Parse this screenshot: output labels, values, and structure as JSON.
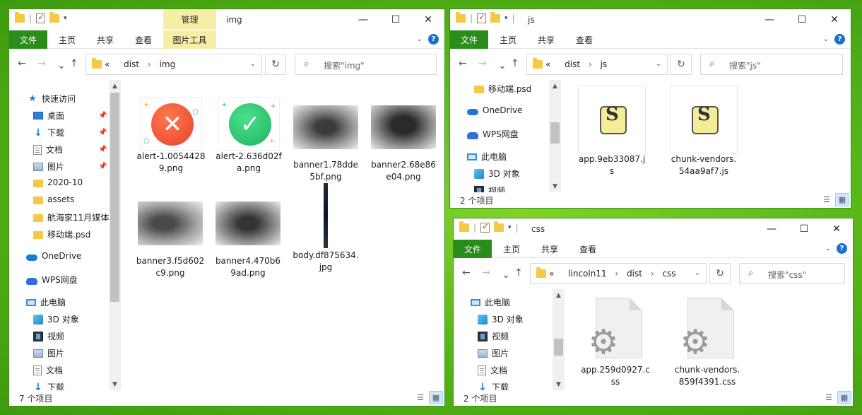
{
  "img_window": {
    "title": "img",
    "manage_tab": "管理",
    "tabs": [
      "文件",
      "主页",
      "共享",
      "查看",
      "图片工具"
    ],
    "address": {
      "chevrons": "«",
      "crumbs": [
        "dist",
        "img"
      ]
    },
    "search_placeholder": "搜索\"img\"",
    "nav": [
      {
        "label": "快速访问",
        "icon": "star-icon"
      },
      {
        "label": "桌面",
        "icon": "desktop-icon",
        "pinned": true
      },
      {
        "label": "下载",
        "icon": "download-icon",
        "pinned": true
      },
      {
        "label": "文档",
        "icon": "document-icon",
        "pinned": true
      },
      {
        "label": "图片",
        "icon": "pictures-icon",
        "pinned": true
      },
      {
        "label": "2020-10",
        "icon": "folder-icon"
      },
      {
        "label": "assets",
        "icon": "folder-icon"
      },
      {
        "label": "航海家11月媒体",
        "icon": "folder-icon"
      },
      {
        "label": "移动端.psd",
        "icon": "folder-icon"
      },
      {
        "label": "OneDrive",
        "icon": "onedrive-icon"
      },
      {
        "label": "WPS网盘",
        "icon": "wps-cloud-icon"
      },
      {
        "label": "此电脑",
        "icon": "this-pc-icon"
      },
      {
        "label": "3D 对象",
        "icon": "3d-objects-icon"
      },
      {
        "label": "视频",
        "icon": "videos-icon"
      },
      {
        "label": "图片",
        "icon": "pictures-icon"
      },
      {
        "label": "文档",
        "icon": "document-icon"
      },
      {
        "label": "下载",
        "icon": "download-icon"
      }
    ],
    "files": [
      {
        "name": "alert-1.00544289.png",
        "line1": "alert-1.0054428",
        "line2": "9.png",
        "kind": "alert-error"
      },
      {
        "name": "alert-2.636d02fa.png",
        "line1": "alert-2.636d02f",
        "line2": "a.png",
        "kind": "alert-success"
      },
      {
        "name": "banner1.78dde5bf.png",
        "line1": "banner1.78dde",
        "line2": "5bf.png",
        "kind": "photo"
      },
      {
        "name": "banner2.68e86e04.png",
        "line1": "banner2.68e86",
        "line2": "e04.png",
        "kind": "photo"
      },
      {
        "name": "banner3.f5d602c9.png",
        "line1": "banner3.f5d602",
        "line2": "c9.png",
        "kind": "photo"
      },
      {
        "name": "banner4.470b69ad.png",
        "line1": "banner4.470b6",
        "line2": "9ad.png",
        "kind": "photo"
      },
      {
        "name": "body.df875634.jpg",
        "line1": "body.df875634.",
        "line2": "jpg",
        "kind": "tall-photo"
      }
    ],
    "status": "7 个项目"
  },
  "js_window": {
    "title": "js",
    "tabs": [
      "文件",
      "主页",
      "共享",
      "查看"
    ],
    "address": {
      "chevrons": "«",
      "crumbs": [
        "dist",
        "js"
      ]
    },
    "search_placeholder": "搜索\"js\"",
    "nav": [
      {
        "label": "移动端.psd",
        "icon": "folder-icon"
      },
      {
        "label": "OneDrive",
        "icon": "onedrive-icon"
      },
      {
        "label": "WPS网盘",
        "icon": "wps-cloud-icon"
      },
      {
        "label": "此电脑",
        "icon": "this-pc-icon"
      },
      {
        "label": "3D 对象",
        "icon": "3d-objects-icon"
      },
      {
        "label": "视频",
        "icon": "videos-icon"
      }
    ],
    "files": [
      {
        "line1": "app.9eb33087.j",
        "line2": "s"
      },
      {
        "line1": "chunk-vendors.",
        "line2": "54aa9af7.js"
      }
    ],
    "status": "2 个项目"
  },
  "css_window": {
    "title": "css",
    "tabs": [
      "文件",
      "主页",
      "共享",
      "查看"
    ],
    "address": {
      "chevrons": "«",
      "crumbs": [
        "lincoln11",
        "dist",
        "css"
      ]
    },
    "search_placeholder": "搜索\"css\"",
    "nav": [
      {
        "label": "此电脑",
        "icon": "this-pc-icon"
      },
      {
        "label": "3D 对象",
        "icon": "3d-objects-icon"
      },
      {
        "label": "视频",
        "icon": "videos-icon"
      },
      {
        "label": "图片",
        "icon": "pictures-icon"
      },
      {
        "label": "文档",
        "icon": "document-icon"
      },
      {
        "label": "下载",
        "icon": "download-icon"
      }
    ],
    "files": [
      {
        "line1": "app.259d0927.c",
        "line2": "ss"
      },
      {
        "line1": "chunk-vendors.",
        "line2": "859f4391.css"
      }
    ],
    "status": "2 个项目"
  },
  "colors": {
    "accent_green": "#2a8c1a",
    "manage_yellow": "#f6eea6",
    "error_red": "#f15a3b",
    "success_green": "#2cc36b",
    "folder_yellow": "#f5c948"
  }
}
